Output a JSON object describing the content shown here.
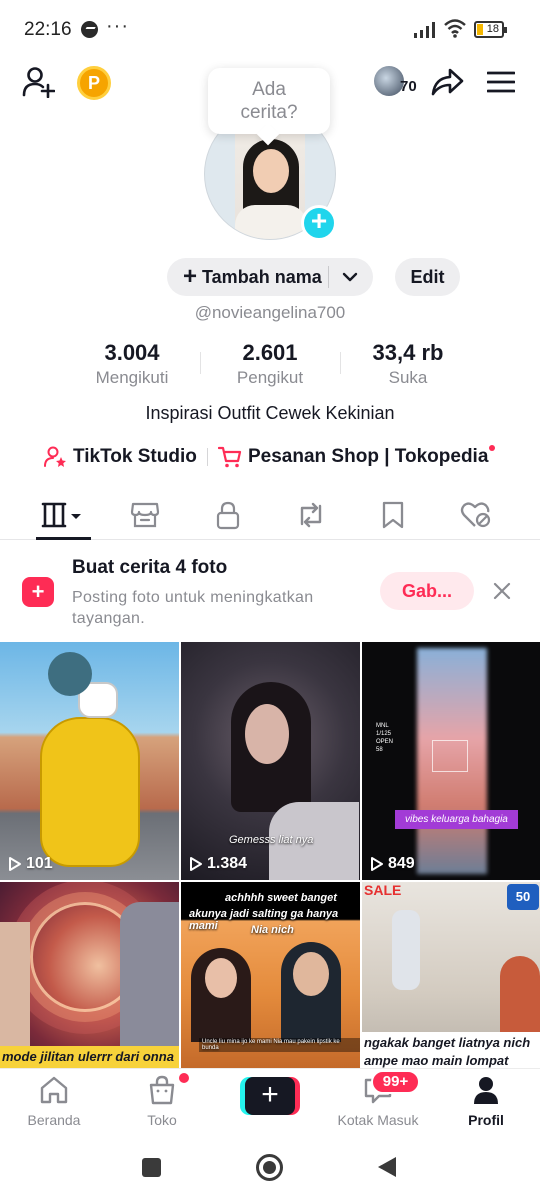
{
  "status_bar": {
    "time": "22:16",
    "dots": "···",
    "battery": "18",
    "icons": [
      "messenger-icon",
      "signal-icon",
      "wifi-icon",
      "battery-icon"
    ]
  },
  "header": {
    "coin_label": "P",
    "friends_count": "70",
    "icons": [
      "add-user-icon",
      "coin-icon",
      "share-icon",
      "menu-icon"
    ]
  },
  "story_bubble": {
    "line1": "Ada",
    "line2": "cerita?"
  },
  "profile": {
    "add_name_label": "Tambah nama",
    "edit_label": "Edit",
    "username": "@novieangelina700",
    "bio": "Inspirasi Outfit Cewek Kekinian"
  },
  "stats": [
    {
      "value": "3.004",
      "label": "Mengikuti"
    },
    {
      "value": "2.601",
      "label": "Pengikut"
    },
    {
      "value": "33,4 rb",
      "label": "Suka"
    }
  ],
  "links": {
    "studio": "TikTok Studio",
    "shop": "Pesanan Shop | Tokopedia"
  },
  "tabs": [
    "videos-grid-icon",
    "shop-icon",
    "lock-icon",
    "repost-icon",
    "bookmark-icon",
    "liked-heart-icon"
  ],
  "story_prompt": {
    "title": "Buat cerita 4 foto",
    "subtitle": "Posting foto untuk meningkatkan tayangan.",
    "button": "Gab..."
  },
  "videos": [
    {
      "views": "101"
    },
    {
      "views": "1.384",
      "caption": "Gemesss liat nya"
    },
    {
      "views": "849",
      "caption": "vibes keluarga bahagia",
      "overlay": [
        "MNL",
        "1/125",
        "OPEN",
        "58"
      ]
    },
    {
      "caption": "mode jilitan ulerrr dari onna"
    },
    {
      "caption_top": "achhhh sweet banget",
      "caption_mid": "akunya jadi salting ga hanya mami",
      "caption_sub": "Nia nich",
      "caption_small": "Uncle liu mina ijo ke mami Nia mau pakein lipstik ke bunda"
    },
    {
      "caption_line1": "ngakak banget liatnya nich",
      "caption_line2": "ampe mao main lompat",
      "sale_text": "SALE",
      "badge_text": "50"
    }
  ],
  "bottom_nav": {
    "home": "Beranda",
    "shop": "Toko",
    "inbox": "Kotak Masuk",
    "inbox_badge": "99+",
    "profile": "Profil"
  },
  "colors": {
    "accent": "#fe2c55",
    "cyan": "#25f4ee",
    "text": "#161823",
    "muted": "#8a8b91",
    "coin": "#f6a400"
  }
}
